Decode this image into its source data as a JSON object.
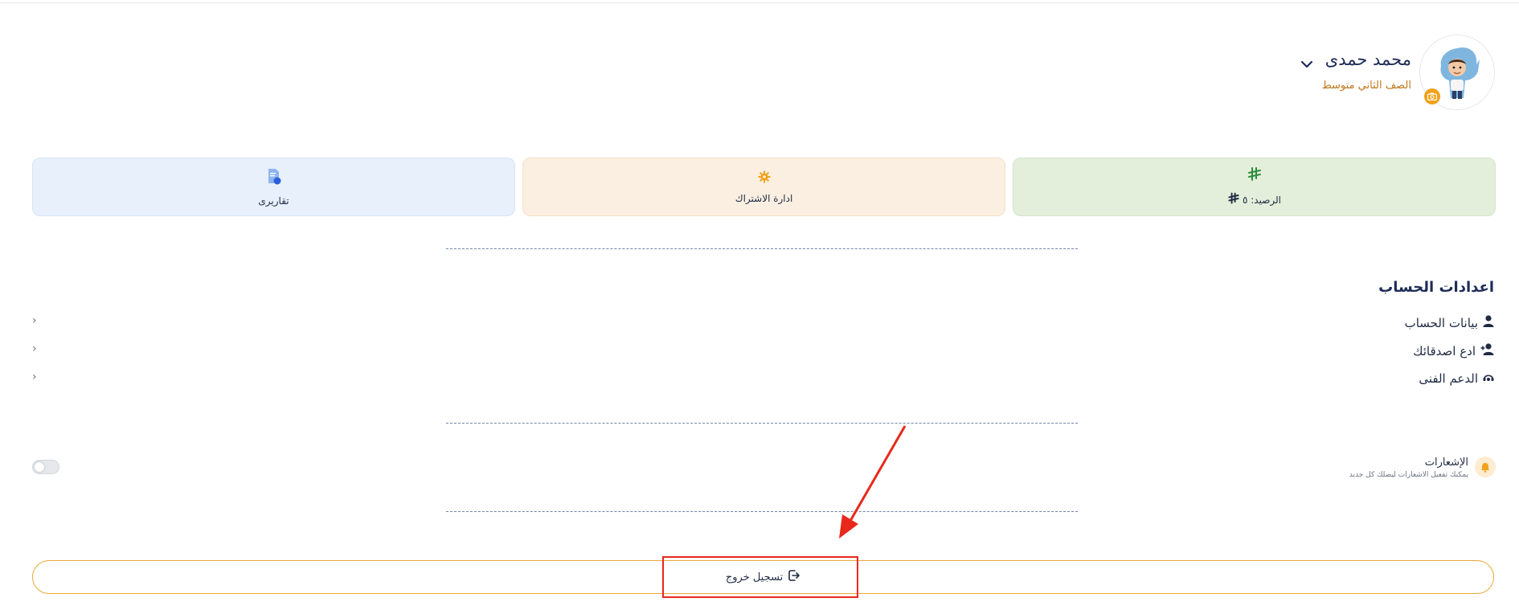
{
  "profile": {
    "name": "محمد حمدى",
    "grade": "الصف الثاني متوسط"
  },
  "cards": [
    {
      "label": "الرصيد: ٥",
      "icon": "riyal-icon",
      "color": "#2e8b3d"
    },
    {
      "label": "ادارة الاشتراك",
      "icon": "gear-icon",
      "color": "#f0a21b"
    },
    {
      "label": "تقاريرى",
      "icon": "report-icon",
      "color": "#2b5fd9"
    }
  ],
  "account_settings": {
    "title": "اعدادات الحساب",
    "items": [
      {
        "label": "بيانات الحساب",
        "icon": "user-icon"
      },
      {
        "label": "ادع اصدقائك",
        "icon": "user-plus-icon"
      },
      {
        "label": "الدعم الفنى",
        "icon": "headset-icon"
      }
    ]
  },
  "notifications": {
    "title": "الإشعارات",
    "subtitle": "يمكنك تفعيل الاشعارات ليصلك كل جديد",
    "enabled": false
  },
  "logout": {
    "label": "تسجيل خروج"
  },
  "colors": {
    "accent_orange": "#e8a93a",
    "annotation_red": "#e8281b",
    "heading_navy": "#1d2b57"
  }
}
